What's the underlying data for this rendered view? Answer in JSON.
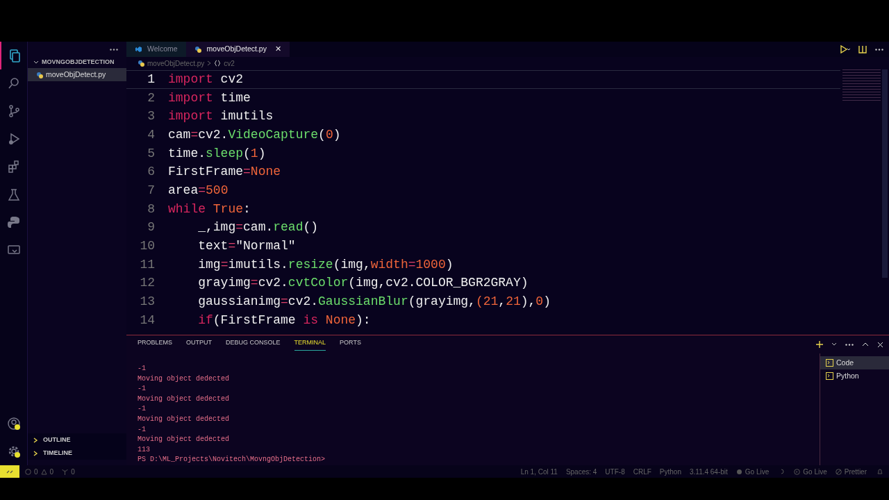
{
  "sidebar": {
    "title": "MOVNGOBJDETECTION",
    "files": [
      {
        "name": "moveObjDetect.py",
        "selected": true
      }
    ],
    "sections": [
      "OUTLINE",
      "TIMELINE"
    ]
  },
  "tabs": [
    {
      "label": "Welcome",
      "kind": "vscode",
      "selected": false
    },
    {
      "label": "moveObjDetect.py",
      "kind": "python",
      "selected": true,
      "close": "✕"
    }
  ],
  "breadcrumb": {
    "file": "moveObjDetect.py",
    "symbol": "cv2"
  },
  "code": [
    {
      "number": "1",
      "tokens": [
        {
          "kind": "keyword",
          "text": "import"
        },
        {
          "kind": "name",
          "text": " cv2"
        }
      ]
    },
    {
      "number": "2",
      "tokens": [
        {
          "kind": "keyword",
          "text": "import"
        },
        {
          "kind": "name",
          "text": " time"
        }
      ]
    },
    {
      "number": "3",
      "tokens": [
        {
          "kind": "keyword",
          "text": "import"
        },
        {
          "kind": "name",
          "text": " imutils"
        }
      ]
    },
    {
      "number": "4",
      "tokens": [
        {
          "kind": "name",
          "text": "cam"
        },
        {
          "kind": "operator",
          "text": "="
        },
        {
          "kind": "name",
          "text": "cv2."
        },
        {
          "kind": "function",
          "text": "VideoCapture"
        },
        {
          "kind": "name",
          "text": "("
        },
        {
          "kind": "literal",
          "text": "0"
        },
        {
          "kind": "name",
          "text": ")"
        }
      ]
    },
    {
      "number": "5",
      "tokens": [
        {
          "kind": "name",
          "text": "time."
        },
        {
          "kind": "function",
          "text": "sleep"
        },
        {
          "kind": "name",
          "text": "("
        },
        {
          "kind": "literal",
          "text": "1"
        },
        {
          "kind": "name",
          "text": ")"
        }
      ]
    },
    {
      "number": "6",
      "tokens": [
        {
          "kind": "name",
          "text": "FirstFrame"
        },
        {
          "kind": "operator",
          "text": "="
        },
        {
          "kind": "literal",
          "text": "None"
        }
      ]
    },
    {
      "number": "7",
      "tokens": [
        {
          "kind": "name",
          "text": "area"
        },
        {
          "kind": "operator",
          "text": "="
        },
        {
          "kind": "literal",
          "text": "500"
        }
      ]
    },
    {
      "number": "8",
      "tokens": [
        {
          "kind": "keyword",
          "text": "while"
        },
        {
          "kind": "literal",
          "text": " True"
        },
        {
          "kind": "name",
          "text": ":"
        }
      ]
    },
    {
      "number": "9",
      "tokens": [
        {
          "kind": "name",
          "text": "    _,img"
        },
        {
          "kind": "operator",
          "text": "="
        },
        {
          "kind": "name",
          "text": "cam."
        },
        {
          "kind": "function",
          "text": "read"
        },
        {
          "kind": "name",
          "text": "()"
        }
      ]
    },
    {
      "number": "10",
      "tokens": [
        {
          "kind": "name",
          "text": "    text"
        },
        {
          "kind": "operator",
          "text": "="
        },
        {
          "kind": "name",
          "text": "\"Normal\""
        }
      ]
    },
    {
      "number": "11",
      "tokens": [
        {
          "kind": "name",
          "text": "    img"
        },
        {
          "kind": "operator",
          "text": "="
        },
        {
          "kind": "name",
          "text": "imutils."
        },
        {
          "kind": "function",
          "text": "resize"
        },
        {
          "kind": "name",
          "text": "(img,"
        },
        {
          "kind": "literal",
          "text": "width"
        },
        {
          "kind": "operator",
          "text": "="
        },
        {
          "kind": "literal",
          "text": "1000"
        },
        {
          "kind": "name",
          "text": ")"
        }
      ]
    },
    {
      "number": "12",
      "tokens": [
        {
          "kind": "name",
          "text": "    grayimg"
        },
        {
          "kind": "operator",
          "text": "="
        },
        {
          "kind": "name",
          "text": "cv2."
        },
        {
          "kind": "function",
          "text": "cvtColor"
        },
        {
          "kind": "name",
          "text": "(img,cv2.COLOR_BGR2GRAY)"
        }
      ]
    },
    {
      "number": "13",
      "tokens": [
        {
          "kind": "name",
          "text": "    gaussianimg"
        },
        {
          "kind": "operator",
          "text": "="
        },
        {
          "kind": "name",
          "text": "cv2."
        },
        {
          "kind": "function",
          "text": "GaussianBlur"
        },
        {
          "kind": "name",
          "text": "(grayimg,"
        },
        {
          "kind": "literal",
          "text": "(21"
        },
        {
          "kind": "name",
          "text": ","
        },
        {
          "kind": "literal",
          "text": "21"
        },
        {
          "kind": "name",
          "text": "),"
        },
        {
          "kind": "literal",
          "text": "0"
        },
        {
          "kind": "name",
          "text": ")"
        }
      ]
    },
    {
      "number": "14",
      "tokens": [
        {
          "kind": "keyword",
          "text": "    if"
        },
        {
          "kind": "name",
          "text": "(FirstFrame "
        },
        {
          "kind": "keyword",
          "text": "is"
        },
        {
          "kind": "literal",
          "text": " None"
        },
        {
          "kind": "name",
          "text": "):"
        }
      ]
    }
  ],
  "panel": {
    "tabs": [
      {
        "label": "PROBLEMS",
        "selected": false
      },
      {
        "label": "OUTPUT",
        "selected": false
      },
      {
        "label": "DEBUG CONSOLE",
        "selected": false
      },
      {
        "label": "TERMINAL",
        "selected": true
      },
      {
        "label": "PORTS",
        "selected": false
      }
    ],
    "terminal": [
      "-1",
      "Moving object dedected",
      "-1",
      "Moving object dedected",
      "-1",
      "Moving object dedected",
      "-1",
      "Moving object dedected",
      "113",
      "PS D:\\ML_Projects\\Novitech\\MovngObjDetection>"
    ],
    "shells": [
      {
        "name": "Code",
        "selected": true
      },
      {
        "name": "Python",
        "selected": false
      }
    ]
  },
  "status_bar": {
    "errors": "0",
    "warnings": "0",
    "ports": "0",
    "items": [
      "Ln 1, Col 11",
      "Spaces: 4",
      "UTF-8",
      "CRLF",
      "Python",
      "3.11.4 64-bit",
      "Go Live",
      "Go Live",
      "Prettier"
    ]
  }
}
